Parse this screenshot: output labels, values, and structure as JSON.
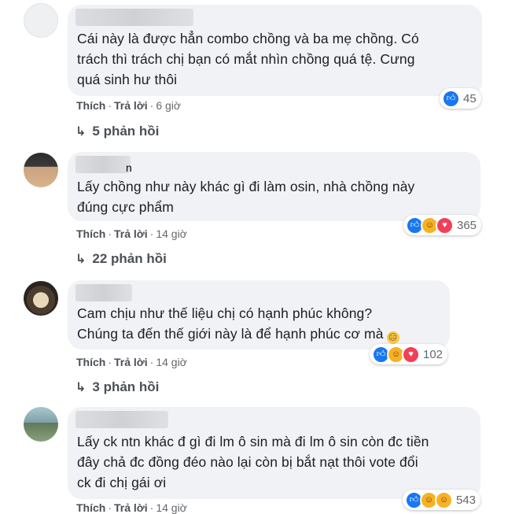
{
  "comments": [
    {
      "name_tail": "",
      "lines": [
        "Cái này là được hẳn combo chồng và ba mẹ chồng. Có",
        "trách thì trách chị bạn có mắt nhìn chồng quá tệ. Cưng",
        "quá sinh hư thôi"
      ],
      "like": "Thích",
      "reply": "Trả lời",
      "time": "6 giờ",
      "reactions": [
        "like"
      ],
      "reaction_count": "45",
      "replies_label": "5 phản hồi"
    },
    {
      "name_tail": "n",
      "lines": [
        "Lấy chồng như này khác gì đi làm osin, nhà chồng này",
        "đúng cực phẩm"
      ],
      "like": "Thích",
      "reply": "Trả lời",
      "time": "14 giờ",
      "reactions": [
        "like",
        "haha",
        "love"
      ],
      "reaction_count": "365",
      "replies_label": "22 phản hồi"
    },
    {
      "name_tail": "",
      "lines": [
        "Cam chịu như thế liệu chị có hạnh phúc không?",
        "Chúng ta đến thế giới này là để hạnh phúc cơ mà"
      ],
      "like": "Thích",
      "reply": "Trả lời",
      "time": "14 giờ",
      "reactions": [
        "like",
        "care",
        "love"
      ],
      "reaction_count": "102",
      "replies_label": "3 phản hồi"
    },
    {
      "name_tail": "",
      "lines": [
        "Lấy ck ntn khác đ gì đi lm ô sin mà đi lm ô sin còn đc tiền",
        "đây chả đc đồng đéo nào lại còn bị bắt nạt thôi vote đổi",
        "ck đi chị gái ơi"
      ],
      "like": "Thích",
      "reply": "Trả lời",
      "time": "14 giờ",
      "reactions": [
        "like",
        "haha",
        "care"
      ],
      "reaction_count": "543"
    }
  ],
  "colors": {
    "like": "#1877f2",
    "love": "#f33e58",
    "haha": "#f7b125",
    "bubble": "#f0f2f5"
  }
}
